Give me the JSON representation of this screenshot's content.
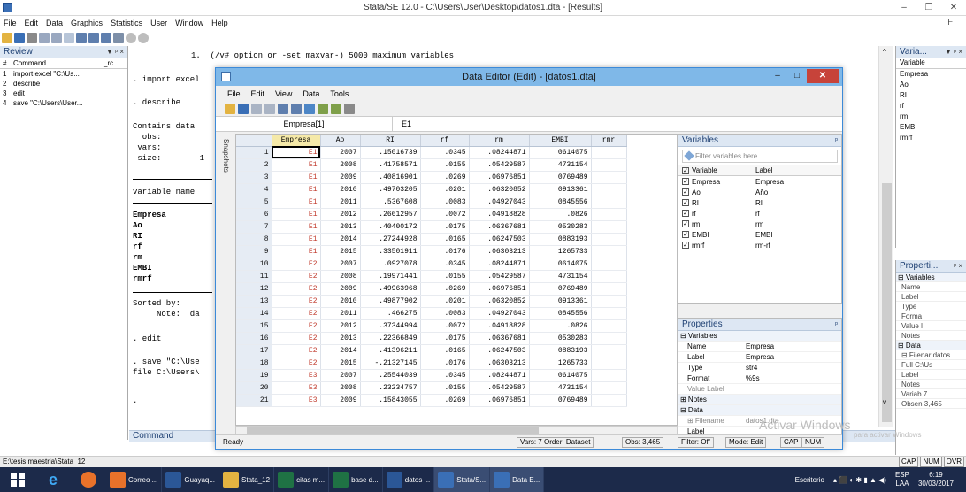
{
  "window": {
    "title": "Stata/SE 12.0 - C:\\Users\\User\\Desktop\\datos1.dta - [Results]",
    "minimize": "–",
    "restore": "❐",
    "close": "✕",
    "menus": [
      "File",
      "Edit",
      "Data",
      "Graphics",
      "Statistics",
      "User",
      "Window",
      "Help"
    ],
    "menu_right_glyph": "ᖴ"
  },
  "review": {
    "title": "Review",
    "pins": "▼ ᵖ ×",
    "col_num": "#",
    "col_command": "Command",
    "col_rc": "_rc",
    "items": [
      {
        "n": "1",
        "cmd": "import excel \"C:\\Us..."
      },
      {
        "n": "2",
        "cmd": "describe"
      },
      {
        "n": "3",
        "cmd": "edit"
      },
      {
        "n": "4",
        "cmd": "save \"C:\\Users\\User..."
      }
    ]
  },
  "results": {
    "lines": [
      "1.  (/v# option or -set maxvar-) 5000 maximum variables",
      ". import excel",
      ". describe",
      "Contains data",
      "  obs:",
      " vars:",
      " size:        1",
      "variable name",
      "Empresa",
      "Ao",
      "RI",
      "rf",
      "rm",
      "EMBI",
      "rmrf",
      "Sorted by:",
      "     Note:  da",
      ". edit",
      ". save \"C:\\Use",
      "file C:\\Users\\",
      "."
    ],
    "scroll_up": "^",
    "scroll_down": "v"
  },
  "command": {
    "title": "Command"
  },
  "statusbar": {
    "path": "E:\\tesis maestria\\Stata_12",
    "caps": "CAP",
    "num": "NUM",
    "ovr": "OVR"
  },
  "right_variables": {
    "title": "Varia...",
    "pins": "▼ ᵖ ×",
    "header": "Variable",
    "items": [
      "Empresa",
      "Ao",
      "RI",
      "rf",
      "rm",
      "EMBI",
      "rmrf"
    ]
  },
  "right_properties": {
    "title": "Properti...",
    "pins": "ᵖ ×",
    "rows": [
      "⊟ Variables",
      "Name",
      "Label",
      "Type",
      "Forma",
      "Value l",
      "Notes",
      "⊟ Data",
      "⊟ Filenar datos",
      "Full C:\\Us",
      "Label",
      "Notes",
      "Variab 7",
      "Obsen 3,465"
    ]
  },
  "data_editor": {
    "title": "Data Editor (Edit) - [datos1.dta]",
    "minimize": "–",
    "restore": "□",
    "close": "✕",
    "menus": [
      "File",
      "Edit",
      "View",
      "Data",
      "Tools"
    ],
    "cell_name": "Empresa[1]",
    "cell_value": "E1",
    "snapshots_label": "Snapshots",
    "columns": [
      "",
      "Empresa",
      "Ao",
      "RI",
      "rf",
      "rm",
      "EMBI",
      "rmr"
    ],
    "rows": [
      [
        "1",
        "E1",
        "2007",
        ".15016739",
        ".0345",
        ".08244871",
        ".0614075"
      ],
      [
        "2",
        "E1",
        "2008",
        ".41758571",
        ".0155",
        ".05429587",
        ".4731154"
      ],
      [
        "3",
        "E1",
        "2009",
        ".40816901",
        ".0269",
        ".06976851",
        ".0769489"
      ],
      [
        "4",
        "E1",
        "2010",
        ".49703205",
        ".0201",
        ".06320852",
        ".0913361"
      ],
      [
        "5",
        "E1",
        "2011",
        ".5367608",
        ".0083",
        ".04927043",
        ".0845556"
      ],
      [
        "6",
        "E1",
        "2012",
        ".26612957",
        ".0072",
        ".04918828",
        ".0826"
      ],
      [
        "7",
        "E1",
        "2013",
        ".40400172",
        ".0175",
        ".06367681",
        ".0530283"
      ],
      [
        "8",
        "E1",
        "2014",
        ".27244928",
        ".0165",
        ".06247503",
        ".0883193"
      ],
      [
        "9",
        "E1",
        "2015",
        ".33501911",
        ".0176",
        ".06303213",
        ".1265733"
      ],
      [
        "10",
        "E2",
        "2007",
        ".0927078",
        ".0345",
        ".08244871",
        ".0614075"
      ],
      [
        "11",
        "E2",
        "2008",
        ".19971441",
        ".0155",
        ".05429587",
        ".4731154"
      ],
      [
        "12",
        "E2",
        "2009",
        ".49963968",
        ".0269",
        ".06976851",
        ".0769489"
      ],
      [
        "13",
        "E2",
        "2010",
        ".49877902",
        ".0201",
        ".06320852",
        ".0913361"
      ],
      [
        "14",
        "E2",
        "2011",
        ".466275",
        ".0083",
        ".04927043",
        ".0845556"
      ],
      [
        "15",
        "E2",
        "2012",
        ".37344994",
        ".0072",
        ".04918828",
        ".0826"
      ],
      [
        "16",
        "E2",
        "2013",
        ".22366849",
        ".0175",
        ".06367681",
        ".0530283"
      ],
      [
        "17",
        "E2",
        "2014",
        ".41396211",
        ".0165",
        ".06247503",
        ".0883193"
      ],
      [
        "18",
        "E2",
        "2015",
        "-.21327145",
        ".0176",
        ".06303213",
        ".1265733"
      ],
      [
        "19",
        "E3",
        "2007",
        ".25544039",
        ".0345",
        ".08244871",
        ".0614075"
      ],
      [
        "20",
        "E3",
        "2008",
        ".23234757",
        ".0155",
        ".05429587",
        ".4731154"
      ],
      [
        "21",
        "E3",
        "2009",
        ".15843055",
        ".0269",
        ".06976851",
        ".0769489"
      ]
    ],
    "variables_panel": {
      "title": "Variables",
      "pin": "ᵖ",
      "filter_placeholder": "Filter variables here",
      "col_variable": "Variable",
      "col_label": "Label",
      "items": [
        {
          "v": "Empresa",
          "l": "Empresa"
        },
        {
          "v": "Ao",
          "l": "Año"
        },
        {
          "v": "RI",
          "l": "RI"
        },
        {
          "v": "rf",
          "l": "rf"
        },
        {
          "v": "rm",
          "l": "rm"
        },
        {
          "v": "EMBI",
          "l": "EMBI"
        },
        {
          "v": "rmrf",
          "l": "rm-rf"
        }
      ]
    },
    "properties_panel": {
      "title": "Properties",
      "pin": "ᵖ",
      "rows": [
        {
          "k": "⊟ Variables",
          "v": "",
          "sec": true
        },
        {
          "k": "Name",
          "v": "Empresa"
        },
        {
          "k": "Label",
          "v": "Empresa"
        },
        {
          "k": "Type",
          "v": "str4"
        },
        {
          "k": "Format",
          "v": "%9s"
        },
        {
          "k": "Value Label",
          "v": "",
          "grey": true
        },
        {
          "k": "⊞ Notes",
          "v": "",
          "sec": true
        },
        {
          "k": "⊟ Data",
          "v": "",
          "sec": true
        },
        {
          "k": "⊞ Filename",
          "v": "datos1.dta",
          "grey": true
        },
        {
          "k": "Label",
          "v": ""
        }
      ]
    },
    "status": {
      "ready": "Ready",
      "vars": "Vars: 7  Order: Dataset",
      "obs": "Obs: 3,465",
      "filter": "Filter: Off",
      "mode": "Mode: Edit",
      "cap": "CAP",
      "num": "NUM"
    }
  },
  "watermark": "Activar Windows",
  "watermark2": "para activar Windows",
  "taskbar": {
    "items": [
      {
        "label": "Correo ...",
        "color": "#e8722a"
      },
      {
        "label": "Guayaq...",
        "color": "#2b5797"
      },
      {
        "label": "Stata_12",
        "color": "#e3b341"
      },
      {
        "label": "citas m...",
        "color": "#1f7244"
      },
      {
        "label": "base d...",
        "color": "#1f7244"
      },
      {
        "label": "datos ...",
        "color": "#2b5797"
      },
      {
        "label": "Stata/S...",
        "color": "#3a6fb6"
      },
      {
        "label": "Data E...",
        "color": "#3a6fb6"
      }
    ],
    "desktop": "Escritorio",
    "lang": "ESP",
    "lang2": "LAA",
    "time": "6:19",
    "date": "30/03/2017",
    "tray_icons": "▴ ⬛ ◐ ✱ ▮ ▲ ◀)"
  }
}
